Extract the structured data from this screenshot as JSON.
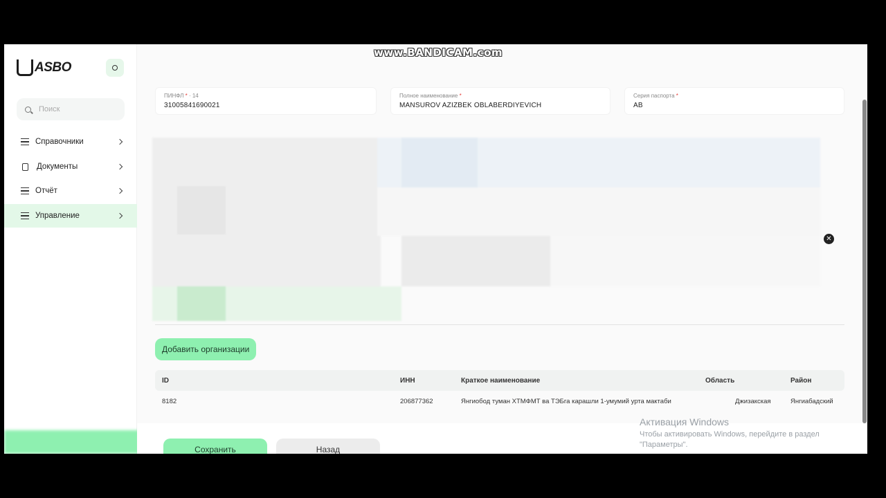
{
  "watermark": "www.BANDICAM.com",
  "logo": {
    "text": "ASBO"
  },
  "search": {
    "placeholder": "Поиск"
  },
  "sidebar": {
    "items": [
      {
        "label": "Справочники",
        "icon": "list-icon"
      },
      {
        "label": "Документы",
        "icon": "document-icon"
      },
      {
        "label": "Отчёт",
        "icon": "list-icon"
      },
      {
        "label": "Управление",
        "icon": "list-icon",
        "active": true
      }
    ]
  },
  "form": {
    "pinfl": {
      "label": "ПИНФЛ",
      "hint": "· 14",
      "value": "31005841690021"
    },
    "full_name": {
      "label": "Полное наименование",
      "value": "MANSUROV AZIZBEK OBLABERDIYEVICH"
    },
    "passport_series": {
      "label": "Серия паспорта",
      "value": "AB"
    }
  },
  "add_org_label": "Добавить организации",
  "table": {
    "headers": [
      "ID",
      "ИНН",
      "Краткое наименование",
      "Область",
      "Район"
    ],
    "rows": [
      [
        "8182",
        "206877362",
        "Янгиобод туман ХТМФМТ ва ТЭБга карашли 1-умумий урта мактаби",
        "Джизакская",
        "Янгиабадский"
      ]
    ]
  },
  "buttons": {
    "save": "Сохранить",
    "back": "Назад"
  },
  "windows_activation": {
    "title": "Активация Windows",
    "text": "Чтобы активировать Windows, перейдите в раздел \"Параметры\"."
  },
  "colors": {
    "accent": "#8ef0b0",
    "active_bg": "#e3f8e8"
  }
}
